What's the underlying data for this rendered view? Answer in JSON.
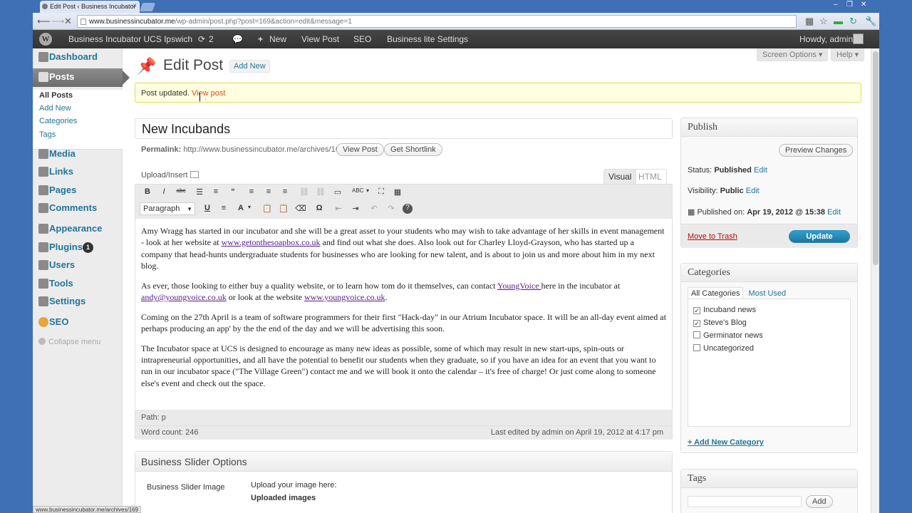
{
  "browser": {
    "tab_title": "Edit Post ‹ Business Incubator",
    "url_host": "www.businessincubator.me",
    "url_path": "/wp-admin/post.php?post=169&action=edit&message=1",
    "status_url": "www.businessincubator.me/archives/169",
    "window_controls": [
      "–",
      "❐",
      "✕"
    ]
  },
  "adminbar": {
    "site_name": "Business Incubator UCS Ipswich",
    "updates_count": "2",
    "new_label": "New",
    "view_post": "View Post",
    "seo": "SEO",
    "theme_settings": "Business lite Settings",
    "howdy": "Howdy, admin"
  },
  "sidebar": {
    "dashboard": "Dashboard",
    "posts": "Posts",
    "posts_sub": [
      "All Posts",
      "Add New",
      "Categories",
      "Tags"
    ],
    "media": "Media",
    "links": "Links",
    "pages": "Pages",
    "comments": "Comments",
    "appearance": "Appearance",
    "plugins": "Plugins",
    "plugins_badge": "1",
    "users": "Users",
    "tools": "Tools",
    "settings": "Settings",
    "seo": "SEO",
    "collapse": "Collapse menu"
  },
  "header": {
    "title": "Edit Post",
    "add_new": "Add New",
    "screen_options": "Screen Options ▾",
    "help": "Help ▾"
  },
  "notice": {
    "text": "Post updated.",
    "link": "View post"
  },
  "post": {
    "title": "New Incubands",
    "permalink_label": "Permalink:",
    "permalink_url": "http://www.businessincubator.me/archives/169",
    "view_post_btn": "View Post",
    "shortlink_btn": "Get Shortlink",
    "upload_insert": "Upload/Insert",
    "tab_visual": "Visual",
    "tab_html": "HTML",
    "format": "Paragraph",
    "p1_a": "Amy Wragg has started in our incubator and she will be a great asset to your students who may wish to take advantage of her skills in event management - look at her website at ",
    "p1_link": "www.getonthesoapbox.co.uk",
    "p1_b": " and find out what she does.   Also look out for Charley Lloyd-Grayson, who has started up a company that head-hunts undergraduate students for businesses who are looking for new talent, and is about to join us and more about him in my next blog.",
    "p2_a": "As ever, those looking to either buy a quality website, or to learn how tom do it themselves, can contact ",
    "p2_link1": "YoungVoice ",
    "p2_b": "here in the incubator at ",
    "p2_link2": "andy@youngvoice.co.uk",
    "p2_c": " or look at the website ",
    "p2_link3": "www.youngvoice.co.uk",
    "p2_d": ".",
    "p3": "Coming on the 27th April is a team of software programmers for their first \"Hack-day\" in our Atrium Incubator space.   It will be an all-day event aimed at perhaps producing an app' by the the end of the day and we will be advertising this soon.",
    "p4": "The Incubator space at UCS is designed to encourage as many new ideas as possible, some of which may result in new start-ups, spin-outs or intrapreneurial opportunities, and all have the potential to benefit our students when they graduate, so if you have an idea for an event that you want to run in our incubator space (\"The Village Green\") contact me and we will book it onto the calendar – it's free of charge! Or just come along to someone else's event and check out the space.",
    "path_label": "Path: p",
    "word_count": "Word count: 246",
    "last_edited": "Last edited by admin on April 19, 2012 at 4:17 pm"
  },
  "slider": {
    "heading": "Business Slider Options",
    "image_label": "Business Slider Image",
    "upload_here": "Upload your image here:",
    "uploaded": "Uploaded images"
  },
  "publish": {
    "heading": "Publish",
    "preview": "Preview Changes",
    "status_label": "Status:",
    "status_value": "Published",
    "visibility_label": "Visibility:",
    "visibility_value": "Public",
    "published_label": "Published on:",
    "published_value": "Apr 19, 2012 @ 15:38",
    "edit": "Edit",
    "trash": "Move to Trash",
    "update": "Update"
  },
  "categories": {
    "heading": "Categories",
    "tab_all": "All Categories",
    "tab_most": "Most Used",
    "items": [
      {
        "label": "Incuband news",
        "checked": true
      },
      {
        "label": "Steve's Blog",
        "checked": true
      },
      {
        "label": "Germinator news",
        "checked": false
      },
      {
        "label": "Uncategorized",
        "checked": false
      }
    ],
    "add_new": "+ Add New Category"
  },
  "tags": {
    "heading": "Tags",
    "add": "Add"
  }
}
